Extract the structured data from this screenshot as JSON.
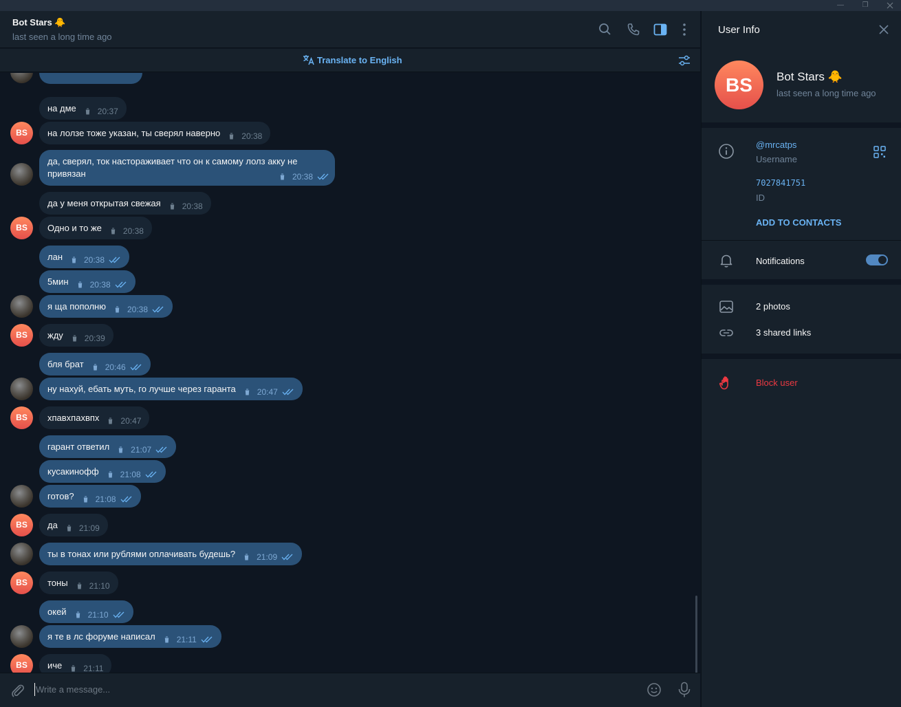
{
  "window": {
    "minimize": "—",
    "restore": "❐"
  },
  "chat": {
    "title": "Bot Stars 🐥",
    "status": "last seen a long time ago",
    "translate": "Translate to English",
    "composer_placeholder": "Write a message..."
  },
  "messages": [
    {
      "text": "на дме",
      "time": "20:37"
    },
    {
      "text": "на лолзе тоже указан, ты сверял наверно",
      "time": "20:38"
    },
    {
      "line1": "да, сверял, ток настораживает что он к самому лолз акку не",
      "line2": "привязан",
      "time": "20:38"
    },
    {
      "text": "да у меня открытая свежая",
      "time": "20:38"
    },
    {
      "text": "Одно и то же",
      "time": "20:38"
    },
    {
      "text": "лан",
      "time": "20:38"
    },
    {
      "text": "5мин",
      "time": "20:38"
    },
    {
      "text": "я ща пополню",
      "time": "20:38"
    },
    {
      "text": "жду",
      "time": "20:39"
    },
    {
      "text": "бля брат",
      "time": "20:46"
    },
    {
      "text": "ну нахуй, ебать муть, го лучше через гаранта",
      "time": "20:47"
    },
    {
      "text": "хпавхпахвпх",
      "time": "20:47"
    },
    {
      "text": "гарант ответил",
      "time": "21:07"
    },
    {
      "text": "кусакинофф",
      "time": "21:08"
    },
    {
      "text": "готов?",
      "time": "21:08"
    },
    {
      "text": "да",
      "time": "21:09"
    },
    {
      "text": "ты в тонах или рублями оплачивать будешь?",
      "time": "21:09"
    },
    {
      "text": "тоны",
      "time": "21:10"
    },
    {
      "text": "окей",
      "time": "21:10"
    },
    {
      "text": "я те в лс форуме написал",
      "time": "21:11"
    },
    {
      "text": "иче",
      "time": "21:11"
    }
  ],
  "avatar_initials": "BS",
  "side": {
    "title": "User Info",
    "name": "Bot Stars 🐥",
    "status": "last seen a long time ago",
    "initials": "BS",
    "username": "@mrcatps",
    "username_label": "Username",
    "id": "7027841751",
    "id_label": "ID",
    "add_contacts": "ADD TO CONTACTS",
    "notifications": "Notifications",
    "notifications_on": true,
    "photos": "2 photos",
    "links": "3 shared links",
    "block": "Block user"
  },
  "colors": {
    "accent": "#6ab3f3",
    "out_bubble": "#2b5278",
    "in_bubble": "#182533",
    "danger": "#ec3942"
  }
}
